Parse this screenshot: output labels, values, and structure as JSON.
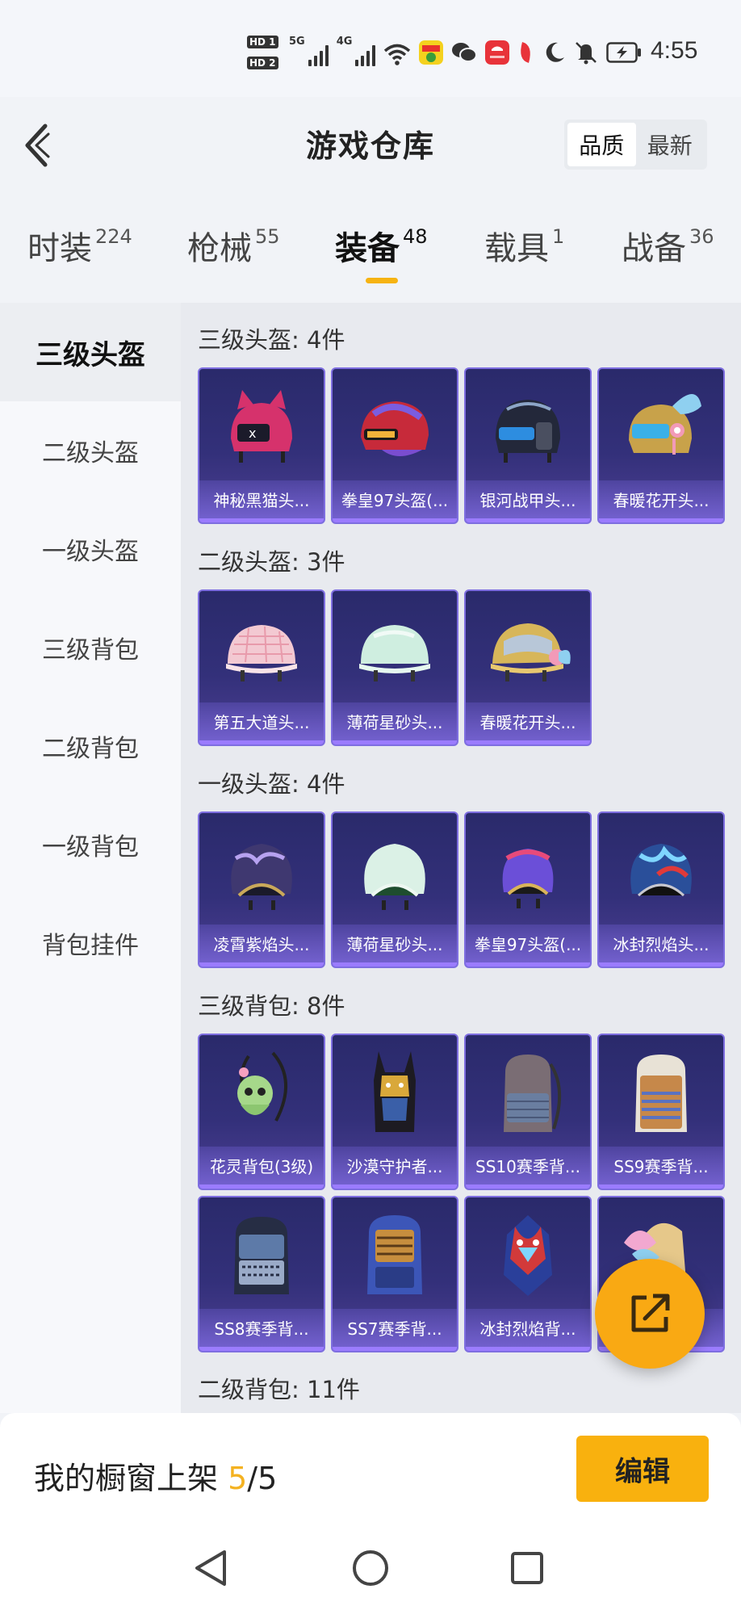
{
  "status_bar": {
    "hd1": "HD 1",
    "hd2": "HD 2",
    "net1": "5G",
    "net2": "4G",
    "time": "4:55",
    "icons": [
      "signal-icon",
      "wifi-icon",
      "app-notification-icon",
      "wechat-icon",
      "huawei-icon",
      "red-app-icon",
      "moon-icon",
      "mute-icon",
      "battery-icon"
    ]
  },
  "header": {
    "title": "游戏仓库",
    "sort_options": [
      "品质",
      "最新"
    ],
    "active_sort": "品质"
  },
  "tabs": [
    {
      "label": "时装",
      "count": "224"
    },
    {
      "label": "枪械",
      "count": "55"
    },
    {
      "label": "装备",
      "count": "48"
    },
    {
      "label": "载具",
      "count": "1"
    },
    {
      "label": "战备",
      "count": "36"
    }
  ],
  "active_tab": "装备",
  "subnav": [
    "三级头盔",
    "二级头盔",
    "一级头盔",
    "三级背包",
    "二级背包",
    "一级背包",
    "背包挂件"
  ],
  "active_subnav": "三级头盔",
  "sections": [
    {
      "title": "三级头盔: 4件",
      "items": [
        "神秘黑猫头...",
        "拳皇97头盔(...",
        "银河战甲头...",
        "春暖花开头..."
      ]
    },
    {
      "title": "二级头盔: 3件",
      "items": [
        "第五大道头...",
        "薄荷星砂头...",
        "春暖花开头..."
      ]
    },
    {
      "title": "一级头盔: 4件",
      "items": [
        "凌霄紫焰头...",
        "薄荷星砂头...",
        "拳皇97头盔(...",
        "冰封烈焰头..."
      ]
    },
    {
      "title": "三级背包: 8件",
      "items": [
        "花灵背包(3级)",
        "沙漠守护者...",
        "SS10赛季背...",
        "SS9赛季背...",
        "SS8赛季背...",
        "SS7赛季背...",
        "冰封烈焰背...",
        ""
      ]
    },
    {
      "title": "二级背包: 11件",
      "items": []
    }
  ],
  "bottom_bar": {
    "label": "我的橱窗上架",
    "current": "5",
    "total": "/5",
    "edit_label": "编辑"
  },
  "colors": {
    "accent": "#f9b10e",
    "card_border": "#7e6ee0",
    "card_bg": "#2a2a6b"
  }
}
